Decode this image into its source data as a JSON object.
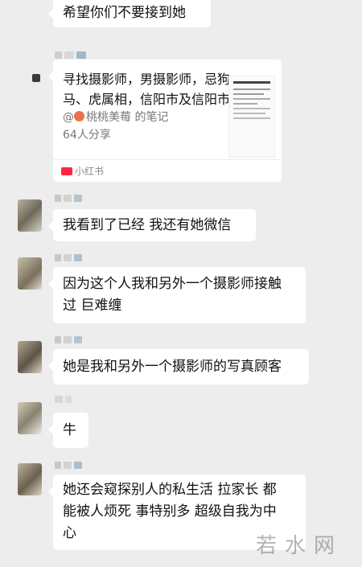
{
  "messages": {
    "m0": "希望你们不要接到她",
    "card": {
      "title_line1": "寻找摄影师，男摄影师，忌狗、",
      "title_line2": "马、虎属相，信阳市及信阳市…",
      "author_prefix": "@",
      "author": "桃桃美莓 的笔记",
      "shares": "64人分享",
      "source": "小红书"
    },
    "m2": "我看到了已经  我还有她微信",
    "m3_line1": "因为这个人我和另外一个摄影师接触",
    "m3_line2": "过 巨难缠",
    "m4": "她是我和另外一个摄影师的写真顾客",
    "m5": "牛",
    "m6_line1": "她还会窥探别人的私生活 拉家长 都",
    "m6_line2": "能被人烦死 事特别多 超级自我为中",
    "m6_line3": "心"
  },
  "watermark": "若水网",
  "colors": {
    "background": "#ededed",
    "bubble": "#ffffff",
    "xhs_red": "#ff2442"
  }
}
